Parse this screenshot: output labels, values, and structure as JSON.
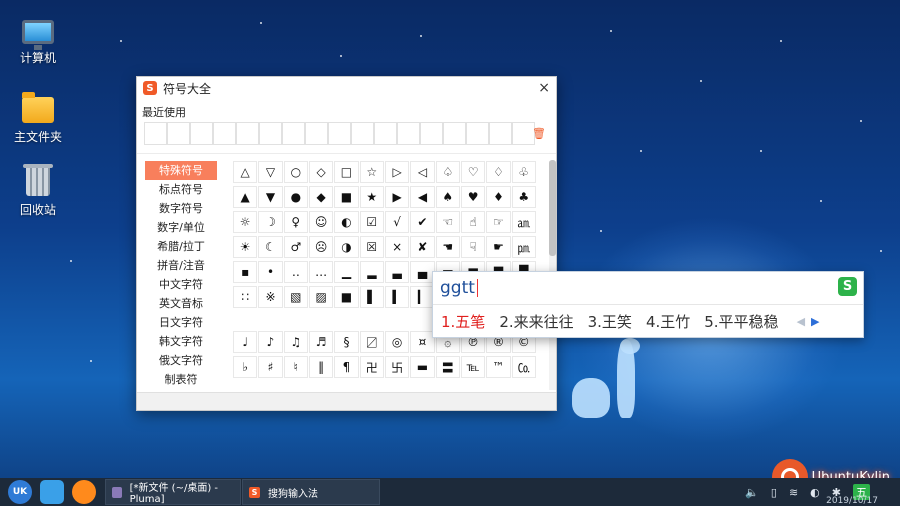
{
  "desktop": {
    "icons": [
      {
        "label": "计算机"
      },
      {
        "label": "主文件夹"
      },
      {
        "label": "回收站"
      }
    ]
  },
  "symbol_window": {
    "title": "符号大全",
    "close_glyph": "×",
    "recent_label": "最近使用",
    "categories": [
      "特殊符号",
      "标点符号",
      "数字符号",
      "数字/单位",
      "希腊/拉丁",
      "拼音/注音",
      "中文字符",
      "英文音标",
      "日文字符",
      "韩文字符",
      "俄文字符",
      "制表符"
    ],
    "active_category": "特殊符号",
    "symbols": [
      [
        "△",
        "▽",
        "○",
        "◇",
        "□",
        "☆",
        "▷",
        "◁",
        "♤",
        "♡",
        "♢",
        "♧"
      ],
      [
        "▲",
        "▼",
        "●",
        "◆",
        "■",
        "★",
        "▶",
        "◀",
        "♠",
        "♥",
        "♦",
        "♣"
      ],
      [
        "☼",
        "☽",
        "♀",
        "☺",
        "◐",
        "☑",
        "√",
        "✔",
        "☜",
        "☝",
        "☞",
        "㏂"
      ],
      [
        "☀",
        "☾",
        "♂",
        "☹",
        "◑",
        "☒",
        "×",
        "✘",
        "☚",
        "☟",
        "☛",
        "㏘"
      ],
      [
        "▪",
        "•",
        "‥",
        "…",
        "▁",
        "▂",
        "▃",
        "▄",
        "▅",
        "▆",
        "▇",
        "█"
      ],
      [
        "∷",
        "※",
        "▧",
        "▨",
        "■",
        "▌",
        "▍",
        "▎",
        "▏",
        "",
        "",
        ""
      ]
    ],
    "symbols_lower": [
      [
        "♩",
        "♪",
        "♫",
        "♬",
        "§",
        "〼",
        "◎",
        "¤",
        "۞",
        "℗",
        "®",
        "©"
      ],
      [
        "♭",
        "♯",
        "♮",
        "‖",
        "¶",
        "卍",
        "卐",
        "▬",
        "〓",
        "℡",
        "™",
        "㏇"
      ]
    ]
  },
  "ime": {
    "input": "ggtt",
    "candidates": [
      "1.五笔",
      "2.来来往往",
      "3.王笑",
      "4.王竹",
      "5.平平稳稳"
    ],
    "selected_index": 0,
    "logo": "S"
  },
  "taskbar": {
    "start_label": "UK",
    "tasks": [
      {
        "label": "[*新文件 (~/桌面) - Pluma]"
      },
      {
        "label": "搜狗输入法"
      }
    ],
    "tray_ime": "五",
    "date": "2019/10/17"
  },
  "brand": {
    "text": "UbuntuKylin",
    "accent": "#e8592a"
  }
}
